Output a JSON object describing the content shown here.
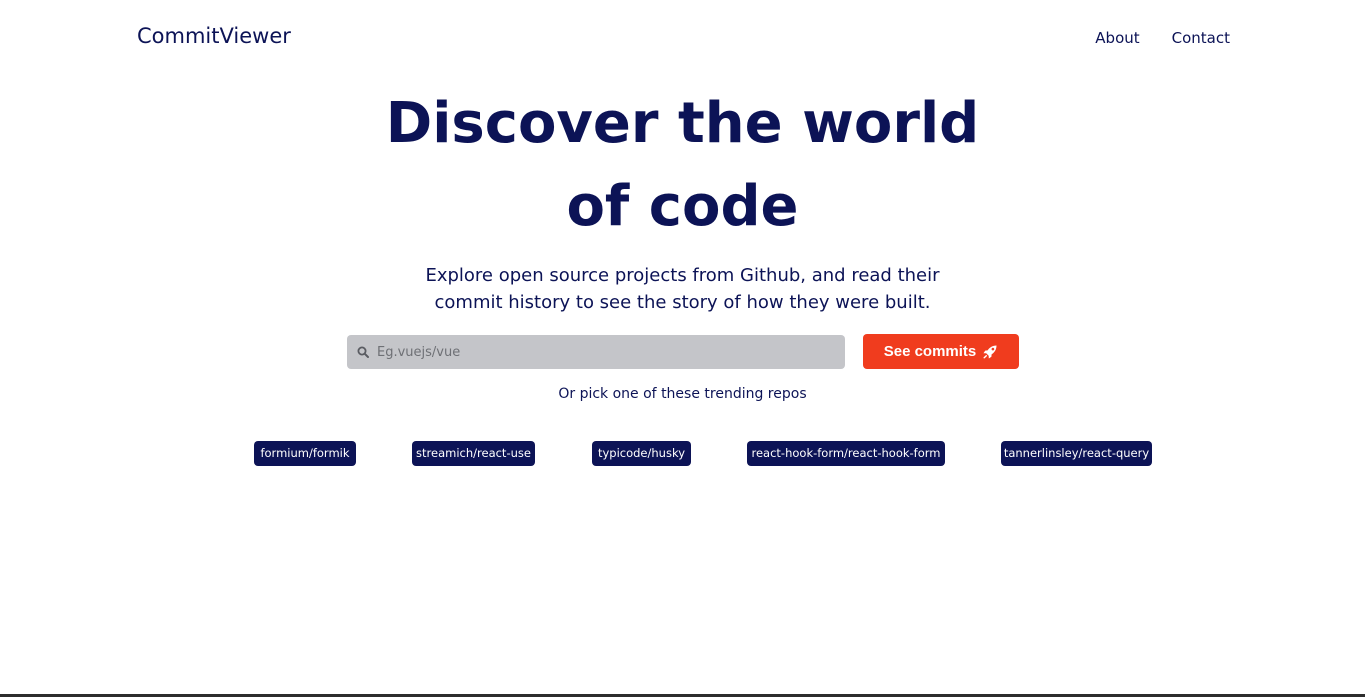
{
  "header": {
    "logo": "CommitViewer",
    "nav": [
      "About",
      "Contact"
    ]
  },
  "hero": {
    "title_line1": "Discover the world",
    "title_line2": "of code",
    "subtitle_line1": "Explore open source projects from Github, and read their",
    "subtitle_line2": "commit history to see the story of how they were built."
  },
  "search": {
    "placeholder": "Eg.vuejs/vue",
    "value": "",
    "icon": "search-icon",
    "button_label": "See commits",
    "button_icon": "rocket-icon"
  },
  "trending": {
    "label": "Or pick one of these trending repos",
    "repos": [
      "formium/formik",
      "streamich/react-use",
      "typicode/husky",
      "react-hook-form/react-hook-form",
      "tannerlinsley/react-query"
    ]
  },
  "colors": {
    "primary": "#0c1356",
    "accent": "#f03c1e",
    "input_bg": "#c4c5c9"
  }
}
